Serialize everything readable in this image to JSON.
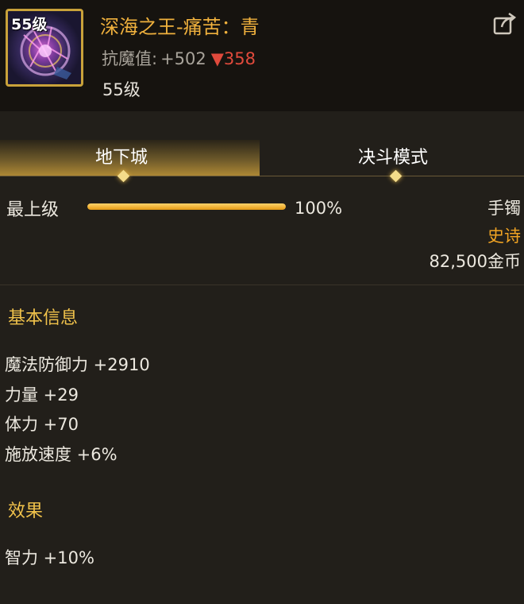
{
  "item": {
    "icon_level": "55级",
    "name": "深海之王-痛苦：青",
    "resist_label": "抗魔值:",
    "resist_plus": "+502",
    "resist_down_arrow": "▼",
    "resist_down": "358",
    "level": "55级",
    "icon": "purple-ring-icon",
    "frame_color": "#c9a23a"
  },
  "share_icon": "share-icon",
  "tabs": [
    {
      "label": "地下城",
      "active": true
    },
    {
      "label": "决斗模式",
      "active": false
    }
  ],
  "grade": {
    "label": "最上级",
    "progress_percent": 100,
    "progress_text": "100%"
  },
  "meta": {
    "slot": "手镯",
    "rarity": "史诗",
    "price": "82,500金币"
  },
  "basic_info": {
    "title": "基本信息",
    "stats": [
      "魔法防御力 +2910",
      "力量 +29",
      "体力 +70",
      "施放速度 +6%"
    ]
  },
  "effects": {
    "title": "效果",
    "stats": [
      "智力 +10%"
    ]
  },
  "colors": {
    "accent_gold": "#f0b13d",
    "epic_orange": "#f0a323",
    "down_red": "#e04a3c",
    "background": "#221f1a"
  }
}
